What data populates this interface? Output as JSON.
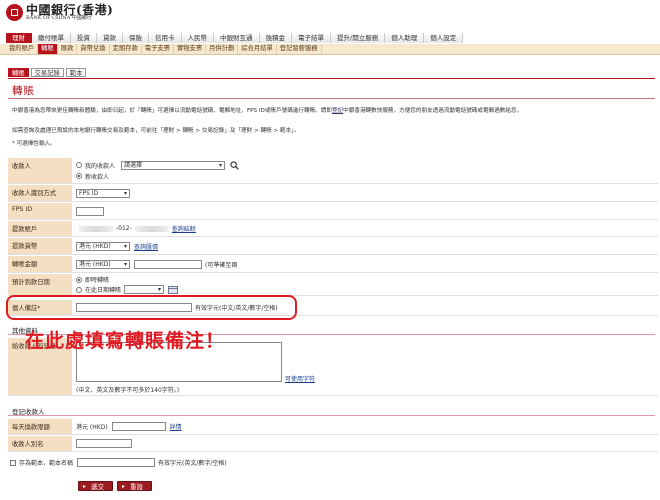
{
  "header": {
    "logo_cn": "中國銀行(香港)",
    "logo_en": "BANK OF CHINA 中國銀行"
  },
  "topnav": [
    {
      "label": "理財",
      "active": true
    },
    {
      "label": "繳付賬單",
      "active": false
    },
    {
      "label": "投資",
      "active": false
    },
    {
      "label": "貸款",
      "active": false
    },
    {
      "label": "保險",
      "active": false
    },
    {
      "label": "信用卡",
      "active": false
    },
    {
      "label": "人民幣",
      "active": false
    },
    {
      "label": "中銀財互通",
      "active": false
    },
    {
      "label": "強積金",
      "active": false
    },
    {
      "label": "電子結單",
      "active": false
    },
    {
      "label": "提升/開立服務",
      "active": false
    },
    {
      "label": "個人助理",
      "active": false
    },
    {
      "label": "個人設定",
      "active": false
    }
  ],
  "subnav": [
    {
      "label": "我的賬戶",
      "active": false
    },
    {
      "label": "轉賬",
      "active": true
    },
    {
      "label": "匯款",
      "active": false
    },
    {
      "label": "貨幣兌換",
      "active": false
    },
    {
      "label": "定期存款",
      "active": false
    },
    {
      "label": "電子支票",
      "active": false
    },
    {
      "label": "實物支票",
      "active": false
    },
    {
      "label": "月供計劃",
      "active": false
    },
    {
      "label": "綜合月結單",
      "active": false
    },
    {
      "label": "登記發薪服務",
      "active": false
    }
  ],
  "tabs": [
    {
      "label": "轉賬",
      "active": true
    },
    {
      "label": "交易記錄",
      "active": false
    },
    {
      "label": "範本",
      "active": false
    }
  ],
  "page_title": "轉賬",
  "notice1_a": "中銀香港為您帶來更佳轉賬新體驗，由即日起，於「轉賬」可選擇以流動電話號碼、電郵地址、FPS ID或賬戶號碼進行轉賬。請即",
  "notice1_link": "登記",
  "notice1_b": "中銀香港轉數快服務，方便您的朋友透過流動電話號碼或電郵過數給您。",
  "notice2": "如需查詢及處理已預設的本地銀行轉賬交易及範本，可前往「理財 > 轉賬 > 交易記錄」及「理財 > 轉賬 > 範本」。",
  "required_note": "* 可選擇性輸入。",
  "form": {
    "payee_label": "收款人",
    "payee_opt1": "我的收款人",
    "payee_select": "請選擇",
    "payee_opt2": "新收款人",
    "id_type_label": "收款人識別方式",
    "id_type_value": "FPS ID",
    "fps_label": "FPS ID",
    "debit_label": "提款賬戶",
    "debit_account": "-012-",
    "debit_link": "查詢結餘",
    "currency_label": "提款貨幣",
    "currency_value": "港元 (HKD)",
    "currency_link": "查詢匯價",
    "amount_label": "轉賬金額",
    "amount_currency": "港元 (HKD)",
    "amount_note": "(可準確至兩",
    "date_label": "預計到款日期",
    "date_opt1": "即時轉賬",
    "date_opt2": "在此日期轉賬",
    "remark_label": "個人備註*",
    "remark_hint": "有效字元(中文/英文/數字/空格)",
    "other_section": "其他資料",
    "message_label": "給收款人的訊息",
    "message_link": "可使用字符",
    "message_hint": "(中文、英文及數字不可多於140字符。)",
    "register_section": "登記收款人",
    "daily_label": "每天換款限額",
    "daily_currency": "港元 (HKD)",
    "daily_link": "詳情",
    "alias_label": "收款人別名",
    "template_label": "存為範本，範本名稱",
    "template_hint": "有效字元(英文/數字/空格)"
  },
  "annotation": "在此處填寫轉賬備注！",
  "buttons": {
    "submit": "遞交",
    "reset": "重設"
  }
}
